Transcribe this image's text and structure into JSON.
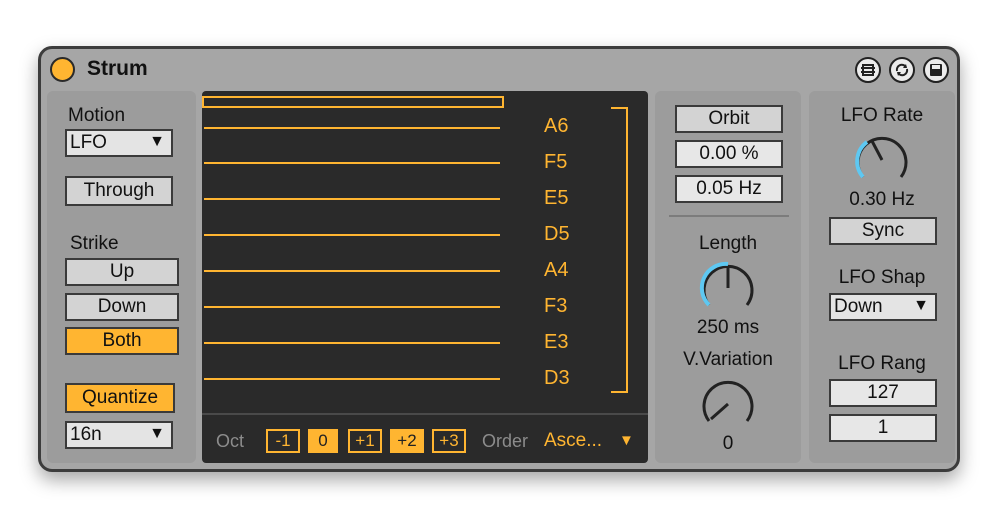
{
  "device": {
    "title": "Strum"
  },
  "left": {
    "motion_label": "Motion",
    "motion_value": "LFO",
    "through_label": "Through",
    "strike_label": "Strike",
    "strike_up": "Up",
    "strike_down": "Down",
    "strike_both": "Both",
    "quantize_label": "Quantize",
    "quantize_value": "16n"
  },
  "display": {
    "notes": [
      "A6",
      "F5",
      "E5",
      "D5",
      "A4",
      "F3",
      "E3",
      "D3"
    ],
    "oct_label": "Oct",
    "oct_buttons": [
      "-1",
      "0",
      "+1",
      "+2",
      "+3"
    ],
    "order_label": "Order",
    "order_value": "Asce..."
  },
  "middle": {
    "orbit_label": "Orbit",
    "orbit_percent": "0.00 %",
    "orbit_hz": "0.05 Hz",
    "length_label": "Length",
    "length_value": "250 ms",
    "variation_label": "V.Variation",
    "variation_value": "0"
  },
  "right": {
    "lfo_rate_label": "LFO Rate",
    "lfo_rate_value": "0.30 Hz",
    "sync_label": "Sync",
    "lfo_shape_label": "LFO Shap",
    "lfo_shape_value": "Down",
    "lfo_range_label": "LFO Rang",
    "lfo_range_high": "127",
    "lfo_range_low": "1"
  },
  "colors": {
    "accent": "#ffb531",
    "knob_arc": "#5ec8f2",
    "display_bg": "#2a2a2a",
    "panel": "#9c9c9c"
  },
  "icons": [
    "power-icon",
    "hotswap-icon",
    "refresh-icon",
    "save-icon",
    "chevron-down-icon"
  ]
}
